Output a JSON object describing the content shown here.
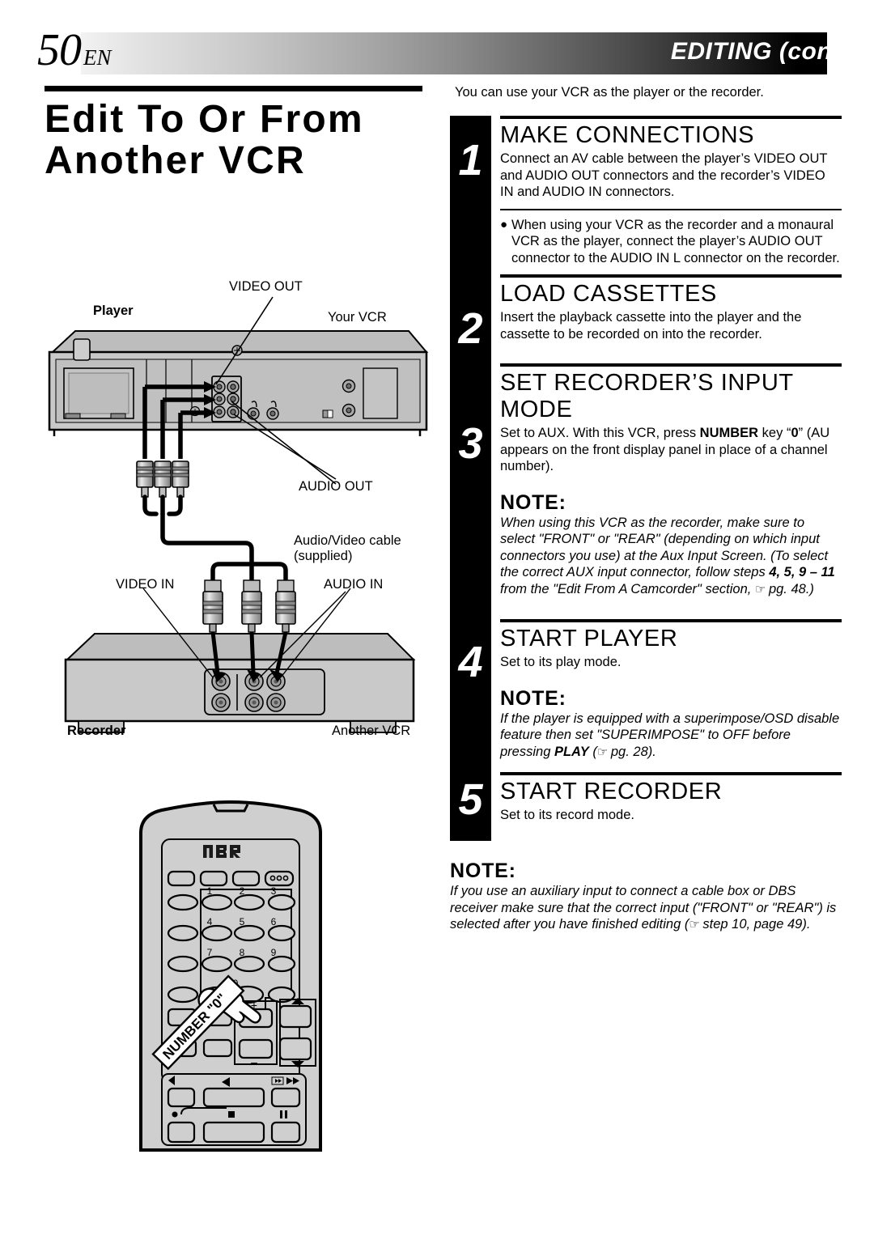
{
  "header": {
    "page_number": "50",
    "page_lang": "EN",
    "section_title": "EDITING (cont.)"
  },
  "title": {
    "heading": "Edit To Or From Another VCR"
  },
  "intro": "You can use your VCR as the player or the recorder.",
  "steps": [
    {
      "number": "1",
      "heading": "MAKE CONNECTIONS",
      "body": "Connect an AV cable between the player’s VIDEO OUT and AUDIO OUT connectors and the recorder’s VIDEO IN and AUDIO IN connectors.",
      "bullet": "When using your VCR as the recorder and a monaural VCR as the player, connect the player’s AUDIO OUT connector to the AUDIO IN L connector on the recorder."
    },
    {
      "number": "2",
      "heading": "LOAD CASSETTES",
      "body": "Insert the playback cassette into the player and the cassette to be recorded on into the recorder."
    },
    {
      "number": "3",
      "heading": "SET RECORDER’S INPUT MODE",
      "body_pre": "Set to AUX. With this VCR, press ",
      "body_bold1": "NUMBER",
      "body_mid": " key “",
      "body_bold2": "0",
      "body_post": "” (AU appears on the front display panel in place of a channel number).",
      "note_label": "NOTE:",
      "note_pre": "When using this VCR as the recorder, make sure to select \"FRONT\" or \"REAR\" (depending on which input connectors you use) at the Aux Input Screen. (To select the correct AUX input connector, follow steps ",
      "note_bold": "4, 5, 9 – 11",
      "note_mid": " from the \"Edit From A Camcorder\" section, ",
      "note_hand": "☞",
      "note_post": " pg. 48.)"
    },
    {
      "number": "4",
      "heading": "START PLAYER",
      "body": "Set to its play mode.",
      "note_label": "NOTE:",
      "note_pre": "If the player is equipped with a superimpose/OSD disable feature then set \"SUPERIMPOSE\" to OFF before pressing ",
      "note_bold": "PLAY",
      "note_mid": " (",
      "note_hand": "☞",
      "note_post": " pg. 28)."
    },
    {
      "number": "5",
      "heading": "START RECORDER",
      "body": "Set to its record mode."
    }
  ],
  "final_note": {
    "label": "NOTE:",
    "pre": "If you use an auxiliary input to connect a cable box or DBS receiver make sure that the correct input (\"FRONT\" or \"REAR\") is selected after you have finished editing (",
    "hand": "☞",
    "post": " step 10, page 49)."
  },
  "diagram": {
    "labels": {
      "video_out": "VIDEO OUT",
      "player": "Player",
      "your_vcr": "Your VCR",
      "audio_out": "AUDIO OUT",
      "av_cable_line1": "Audio/Video cable",
      "av_cable_line2": "(supplied)",
      "video_in": "VIDEO IN",
      "audio_in": "AUDIO IN",
      "recorder": "Recorder",
      "another_vcr": "Another VCR"
    },
    "remote": {
      "brand": "MBR",
      "keys": [
        "1",
        "2",
        "3",
        "4",
        "5",
        "6",
        "7",
        "8",
        "9",
        "0"
      ],
      "plus": "+",
      "minus": "–",
      "callout": "NUMBER \"0\""
    }
  },
  "colors": {
    "ink": "#000000",
    "paper": "#ffffff",
    "device_body": "#c9c9c9",
    "device_top": "#bfbfbf"
  }
}
